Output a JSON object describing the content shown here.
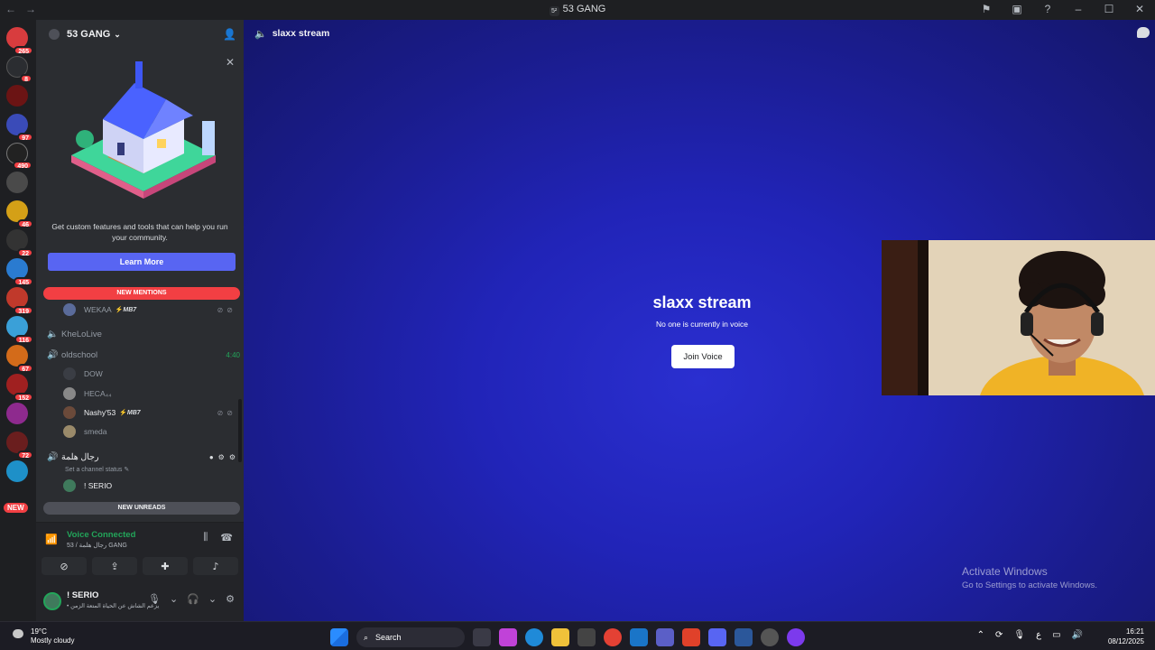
{
  "titlebar": {
    "server_icon_text": "5²",
    "title": "53 GANG",
    "nav_back": "←",
    "nav_forward": "→"
  },
  "server_rail": {
    "badges": [
      "265",
      "8",
      "97",
      "490",
      "46",
      "22",
      "145",
      "319",
      "116",
      "67",
      "152",
      "72"
    ],
    "new_label": "NEW"
  },
  "sidebar": {
    "guild_name": "53 GANG",
    "promo_text": "Get custom features and tools that can help you run your community.",
    "learn_more_label": "Learn More",
    "new_mentions_label": "NEW MENTIONS",
    "top_user": {
      "name": "WEKAA",
      "tag": "MB7"
    },
    "channels": [
      {
        "name": "KheLoLive"
      },
      {
        "name": "oldschool",
        "timer": "4:40"
      }
    ],
    "oldschool_users": [
      {
        "name": "DOW",
        "tag": ""
      },
      {
        "name": "HECA₄₄",
        "tag": ""
      },
      {
        "name": "Nashy'53",
        "tag": "MB7"
      },
      {
        "name": "smeda",
        "tag": ""
      }
    ],
    "arabic_channel": {
      "name": "رجال هلمة",
      "status_placeholder": "Set a channel status"
    },
    "arabic_users": [
      {
        "name": "! SERIO"
      }
    ],
    "new_unreads_label": "NEW UNREADS",
    "hidden_channel": "slaxx stream"
  },
  "voice_panel": {
    "title": "Voice Connected",
    "subtitle": "53 / رجال هلمة GANG"
  },
  "user_bar": {
    "name": "! SERIO",
    "status": "• يزعم الشاش عن الحياة المتعة الزمن"
  },
  "main": {
    "channel_name": "slaxx stream",
    "stage_title": "slaxx stream",
    "stage_subtitle": "No one is currently in voice",
    "join_label": "Join Voice",
    "watermark_title": "Activate Windows",
    "watermark_sub": "Go to Settings to activate Windows."
  },
  "taskbar": {
    "weather_temp": "19°C",
    "weather_desc": "Mostly cloudy",
    "search_label": "Search",
    "tray_lang": "ع",
    "time": "16:21",
    "date": "08/12/2025"
  },
  "colors": {
    "discord_blurple": "#5865f2",
    "mention_red": "#f23f43",
    "voice_green": "#23a55a",
    "stage_blue": "#2124b8"
  }
}
